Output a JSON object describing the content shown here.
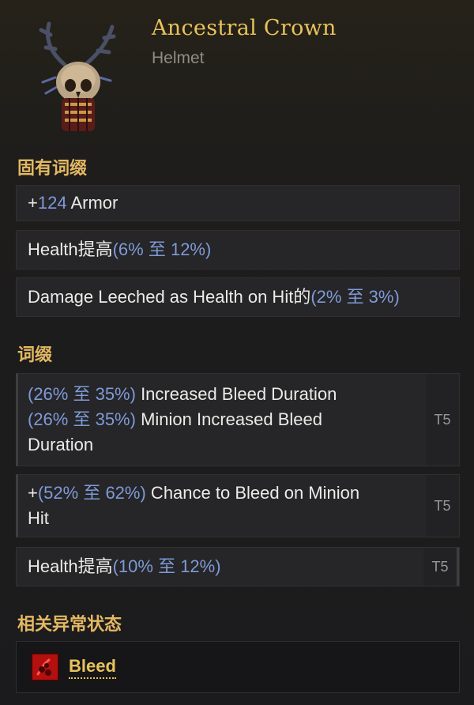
{
  "item": {
    "name": "Ancestral Crown",
    "type": "Helmet",
    "icon": "antlered-skull-helmet-icon"
  },
  "sections": {
    "implicit_title": "固有词缀",
    "affix_title": "词缀",
    "ailment_title": "相关异常状态"
  },
  "implicits": [
    {
      "prefix": "+",
      "value": "124",
      "suffix": " Armor"
    },
    {
      "prefix": "Health提高",
      "range": "(6% 至 12%)"
    },
    {
      "prefix": "Damage Leeched as Health on Hit的",
      "range": "(2% 至 3%)"
    }
  ],
  "affixes": [
    {
      "line1_range": "(26% 至 35%)",
      "line1_text": " Increased Bleed Duration",
      "line2_range": "(26% 至 35%)",
      "line2_text": " Minion Increased Bleed",
      "line3_text": "Duration",
      "tier": "T5"
    },
    {
      "line1_prefix": "+",
      "line1_range": "(52% 至 62%)",
      "line1_text": " Chance to Bleed on Minion",
      "line2_text": "Hit",
      "tier": "T5"
    },
    {
      "line1_prefix": "Health提高",
      "line1_range": "(10% 至 12%)",
      "tier": "T5"
    }
  ],
  "ailment": {
    "label": "Bleed",
    "icon": "bleed-icon"
  },
  "colors": {
    "name_gold": "#e8c25a",
    "section_gold": "#e4b863",
    "value_blue": "#7e9bd8",
    "tier_gray": "#99969a"
  }
}
